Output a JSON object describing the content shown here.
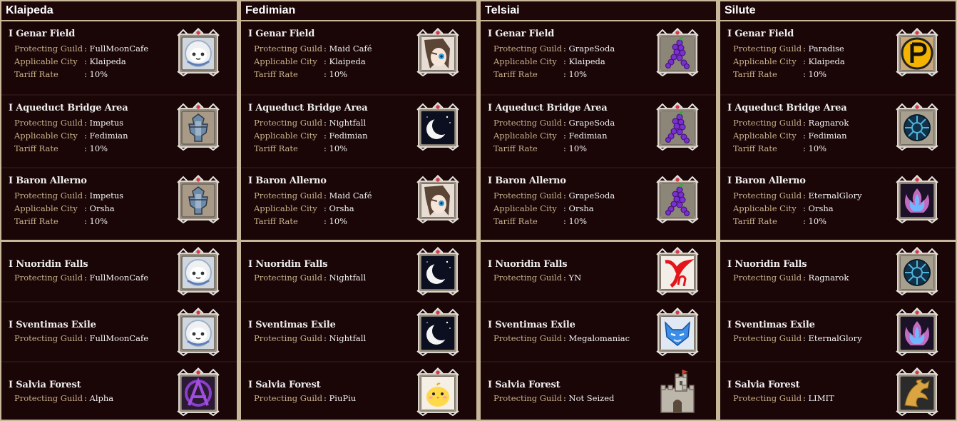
{
  "labels": {
    "protecting_guild": "Protecting Guild",
    "applicable_city": "Applicable City",
    "tariff_rate": "Tariff Rate"
  },
  "columns": [
    {
      "city": "Klaipeda",
      "upper": [
        {
          "name": "I Genar Field",
          "guild": ": FullMoonCafe",
          "city": ": Klaipeda",
          "tariff": ": 10%",
          "emblem": "moon-face-icon"
        },
        {
          "name": "I Aqueduct Bridge Area",
          "guild": ": Impetus",
          "city": ": Fedimian",
          "tariff": ": 10%",
          "emblem": "armor-crest-icon"
        },
        {
          "name": "I Baron Allerno",
          "guild": ": Impetus",
          "city": ": Orsha",
          "tariff": ": 10%",
          "emblem": "armor-crest-icon"
        }
      ],
      "lower": [
        {
          "name": "I Nuoridin Falls",
          "guild": ": FullMoonCafe",
          "emblem": "moon-face-icon"
        },
        {
          "name": "I Sventimas Exile",
          "guild": ": FullMoonCafe",
          "emblem": "moon-face-icon"
        },
        {
          "name": "I Salvia Forest",
          "guild": ": Alpha",
          "emblem": "anarchy-a-icon"
        }
      ]
    },
    {
      "city": "Fedimian",
      "upper": [
        {
          "name": "I Genar Field",
          "guild": ": Maid Café",
          "city": ": Klaipeda",
          "tariff": ": 10%",
          "emblem": "anime-girl-icon"
        },
        {
          "name": "I Aqueduct Bridge Area",
          "guild": ": Nightfall",
          "city": ": Fedimian",
          "tariff": ": 10%",
          "emblem": "crescent-moon-icon"
        },
        {
          "name": "I Baron Allerno",
          "guild": ": Maid Café",
          "city": ": Orsha",
          "tariff": ": 10%",
          "emblem": "anime-girl-icon"
        }
      ],
      "lower": [
        {
          "name": "I Nuoridin Falls",
          "guild": ": Nightfall",
          "emblem": "crescent-moon-icon"
        },
        {
          "name": "I Sventimas Exile",
          "guild": ": Nightfall",
          "emblem": "crescent-moon-icon"
        },
        {
          "name": "I Salvia Forest",
          "guild": ": PiuPiu",
          "emblem": "chick-icon"
        }
      ]
    },
    {
      "city": "Telsiai",
      "upper": [
        {
          "name": "I Genar Field",
          "guild": ": GrapeSoda",
          "city": ": Klaipeda",
          "tariff": ": 10%",
          "emblem": "grape-figure-icon"
        },
        {
          "name": "I Aqueduct Bridge Area",
          "guild": ": GrapeSoda",
          "city": ": Fedimian",
          "tariff": ": 10%",
          "emblem": "grape-figure-icon"
        },
        {
          "name": "I Baron Allerno",
          "guild": ": GrapeSoda",
          "city": ": Orsha",
          "tariff": ": 10%",
          "emblem": "grape-figure-icon"
        }
      ],
      "lower": [
        {
          "name": "I Nuoridin Falls",
          "guild": ": YN",
          "emblem": "yn-letters-icon"
        },
        {
          "name": "I Sventimas Exile",
          "guild": ": Megalomaniac",
          "emblem": "blue-fox-icon"
        },
        {
          "name": "I Salvia Forest",
          "guild": ": Not Seized",
          "emblem": "castle-icon"
        }
      ]
    },
    {
      "city": "Silute",
      "upper": [
        {
          "name": "I Genar Field",
          "guild": ": Paradise",
          "city": ": Klaipeda",
          "tariff": ": 10%",
          "emblem": "p-letter-icon"
        },
        {
          "name": "I Aqueduct Bridge Area",
          "guild": ": Ragnarok",
          "city": ": Fedimian",
          "tariff": ": 10%",
          "emblem": "rune-wheel-icon"
        },
        {
          "name": "I Baron Allerno",
          "guild": ": EternalGlory",
          "city": ": Orsha",
          "tariff": ": 10%",
          "emblem": "blue-flame-icon"
        }
      ],
      "lower": [
        {
          "name": "I Nuoridin Falls",
          "guild": ": Ragnarok",
          "emblem": "rune-wheel-icon"
        },
        {
          "name": "I Sventimas Exile",
          "guild": ": EternalGlory",
          "emblem": "blue-flame-icon"
        },
        {
          "name": "I Salvia Forest",
          "guild": ": LIMIT",
          "emblem": "golden-dragon-icon"
        }
      ]
    }
  ]
}
